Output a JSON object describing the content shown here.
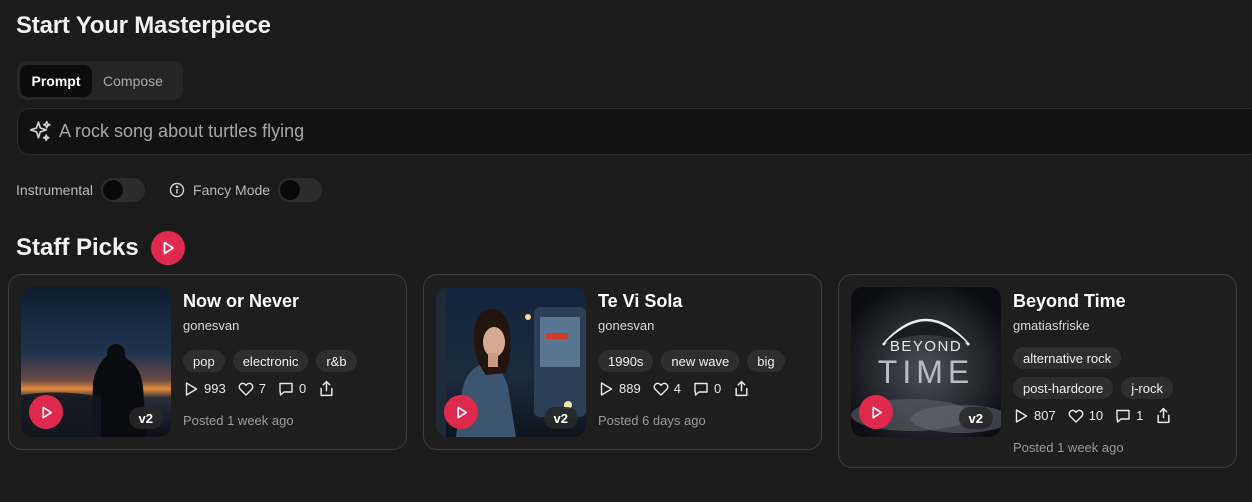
{
  "page_title": "Start Your Masterpiece",
  "tabs": [
    {
      "label": "Prompt",
      "active": true
    },
    {
      "label": "Compose",
      "active": false
    }
  ],
  "prompt": {
    "placeholder": "A rock song about turtles flying",
    "icon": "sparkles-icon"
  },
  "options": {
    "instrumental_label": "Instrumental",
    "instrumental_on": false,
    "fancy_label": "Fancy Mode",
    "fancy_on": false
  },
  "section": {
    "title": "Staff Picks"
  },
  "colors": {
    "accent": "#e0294f",
    "background": "#1c1b1b",
    "card_border": "#3e3d3d"
  },
  "cards": [
    {
      "title": "Now or Never",
      "artist": "gonesvan",
      "version": "v2",
      "tags": [
        "pop",
        "electronic",
        "r&b"
      ],
      "plays": "993",
      "likes": "7",
      "comments": "0",
      "posted": "Posted 1 week ago"
    },
    {
      "title": "Te Vi Sola",
      "artist": "gonesvan",
      "version": "v2",
      "tags": [
        "1990s",
        "new wave",
        "big"
      ],
      "plays": "889",
      "likes": "4",
      "comments": "0",
      "posted": "Posted 6 days ago"
    },
    {
      "title": "Beyond Time",
      "artist": "gmatiasfriske",
      "version": "v2",
      "cover_text": [
        "BEYOND",
        "TIME"
      ],
      "tags": [
        "alternative rock",
        "post-hardcore",
        "j-rock"
      ],
      "plays": "807",
      "likes": "10",
      "comments": "1",
      "posted": "Posted 1 week ago"
    }
  ]
}
